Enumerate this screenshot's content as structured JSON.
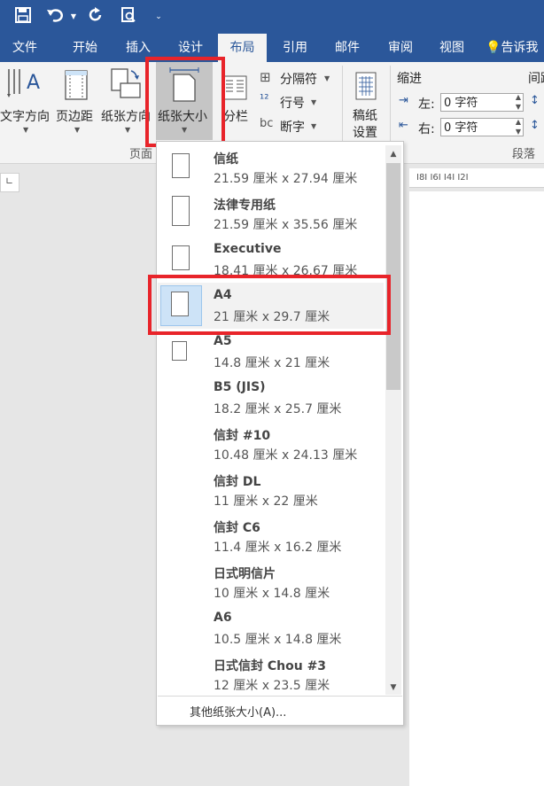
{
  "qat": {
    "save_icon": "save-icon",
    "undo_icon": "undo-icon",
    "redo_icon": "repeat-icon",
    "preview_icon": "print-preview-icon",
    "customize_icon": "customize-qat-icon"
  },
  "tabs": [
    "文件",
    "开始",
    "插入",
    "设计",
    "布局",
    "引用",
    "邮件",
    "审阅",
    "视图"
  ],
  "tell_me": "告诉我",
  "ribbon": {
    "text_direction": "文字方向",
    "margins": "页边距",
    "orientation": "纸张方向",
    "size": "纸张大小",
    "columns": "分栏",
    "breaks": "分隔符",
    "line_numbers": "行号",
    "hyphenation": "断字",
    "draft_paper_1": "稿纸",
    "draft_paper_2": "设置",
    "indent_title": "缩进",
    "spacing_title": "间距",
    "left_label": "左:",
    "left_value": "0 字符",
    "right_label": "右:",
    "right_value": "0 字符",
    "page_setup_group": "页面",
    "paragraph_group": "段落"
  },
  "ruler_text": "I8I  I6I  I4I  I2I",
  "dropdown": {
    "items": [
      {
        "name": "信纸",
        "size": "21.59 厘米 x 27.94 厘米"
      },
      {
        "name": "法律专用纸",
        "size": "21.59 厘米 x 35.56 厘米"
      },
      {
        "name": "Executive",
        "size": "18.41 厘米 x 26.67 厘米"
      },
      {
        "name": "A4",
        "size": "21 厘米 x 29.7 厘米"
      },
      {
        "name": "A5",
        "size": "14.8 厘米 x 21 厘米"
      },
      {
        "name": "B5 (JIS)",
        "size": "18.2 厘米 x 25.7 厘米"
      },
      {
        "name": "信封 #10",
        "size": "10.48 厘米 x 24.13 厘米"
      },
      {
        "name": "信封 DL",
        "size": "11 厘米 x 22 厘米"
      },
      {
        "name": "信封 C6",
        "size": "11.4 厘米 x 16.2 厘米"
      },
      {
        "name": "日式明信片",
        "size": "10 厘米 x 14.8 厘米"
      },
      {
        "name": "A6",
        "size": "10.5 厘米 x 14.8 厘米"
      },
      {
        "name": "日式信封 Chou #3",
        "size": "12 厘米 x 23.5 厘米"
      }
    ],
    "selected": "A4",
    "more_sizes": "其他纸张大小(A)..."
  },
  "colors": {
    "accent": "#2b579a",
    "highlight": "#e8242a"
  }
}
